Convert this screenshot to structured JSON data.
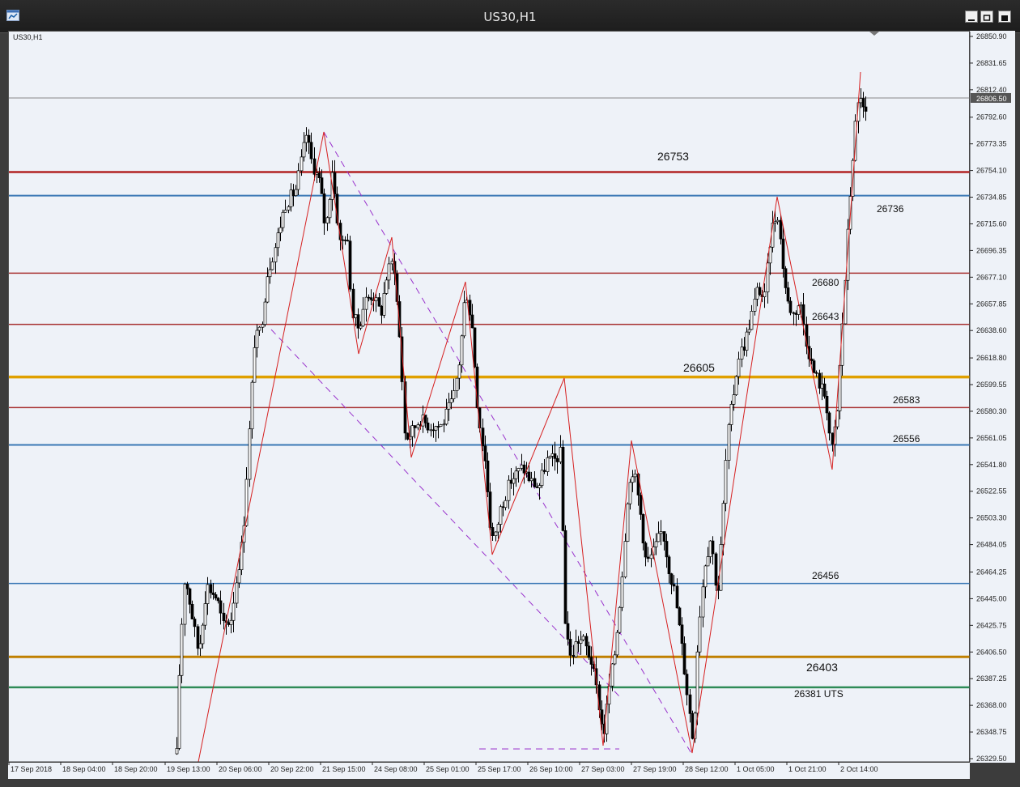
{
  "window": {
    "title": "US30,H1",
    "symbol_label": "US30,H1",
    "controls": [
      "minimize",
      "maximize",
      "close"
    ]
  },
  "chart_data": {
    "type": "candlestick",
    "symbol": "US30",
    "timeframe": "H1",
    "ylim": [
      26329.5,
      26850.9
    ],
    "y_ticks": [
      "26850.90",
      "26831.65",
      "26812.40",
      "26792.60",
      "26773.35",
      "26754.10",
      "26734.85",
      "26715.60",
      "26696.35",
      "26677.10",
      "26657.85",
      "26638.60",
      "26618.80",
      "26599.55",
      "26580.30",
      "26561.05",
      "26541.80",
      "26522.55",
      "26503.30",
      "26484.05",
      "26464.25",
      "26445.00",
      "26425.75",
      "26406.50",
      "26387.25",
      "26368.00",
      "26348.75",
      "26329.50"
    ],
    "x_ticks": [
      "17 Sep 2018",
      "18 Sep 04:00",
      "18 Sep 20:00",
      "19 Sep 13:00",
      "20 Sep 06:00",
      "20 Sep 22:00",
      "21 Sep 15:00",
      "24 Sep 08:00",
      "25 Sep 01:00",
      "25 Sep 17:00",
      "26 Sep 10:00",
      "27 Sep 03:00",
      "27 Sep 19:00",
      "28 Sep 12:00",
      "1 Oct 05:00",
      "1 Oct 21:00",
      "2 Oct 14:00"
    ],
    "current_price": "26806.50",
    "current_price_value": 26806.5,
    "levels": [
      {
        "label": "26753",
        "value": 26753,
        "color": "#b22222",
        "width": 2.5
      },
      {
        "label": "26736",
        "value": 26736,
        "color": "#3a78b5",
        "width": 2
      },
      {
        "label": "26680",
        "value": 26680,
        "color": "#a83232",
        "width": 1.5
      },
      {
        "label": "26643",
        "value": 26643,
        "color": "#a83232",
        "width": 1.5
      },
      {
        "label": "26605",
        "value": 26605,
        "color": "#e0a000",
        "width": 3.5
      },
      {
        "label": "26583",
        "value": 26583,
        "color": "#a83232",
        "width": 1.5
      },
      {
        "label": "26556",
        "value": 26556,
        "color": "#3a78b5",
        "width": 2
      },
      {
        "label": "26456",
        "value": 26456,
        "color": "#3a78b5",
        "width": 1.5
      },
      {
        "label": "26403",
        "value": 26403,
        "color": "#c08000",
        "width": 3
      },
      {
        "label": "26381 UTS",
        "value": 26381,
        "color": "#2e8b57",
        "width": 2.5
      }
    ],
    "zigzag_color": "#d62020",
    "channel_color": "#9932cc",
    "up_color": "#ffffff",
    "down_color": "#000000"
  }
}
